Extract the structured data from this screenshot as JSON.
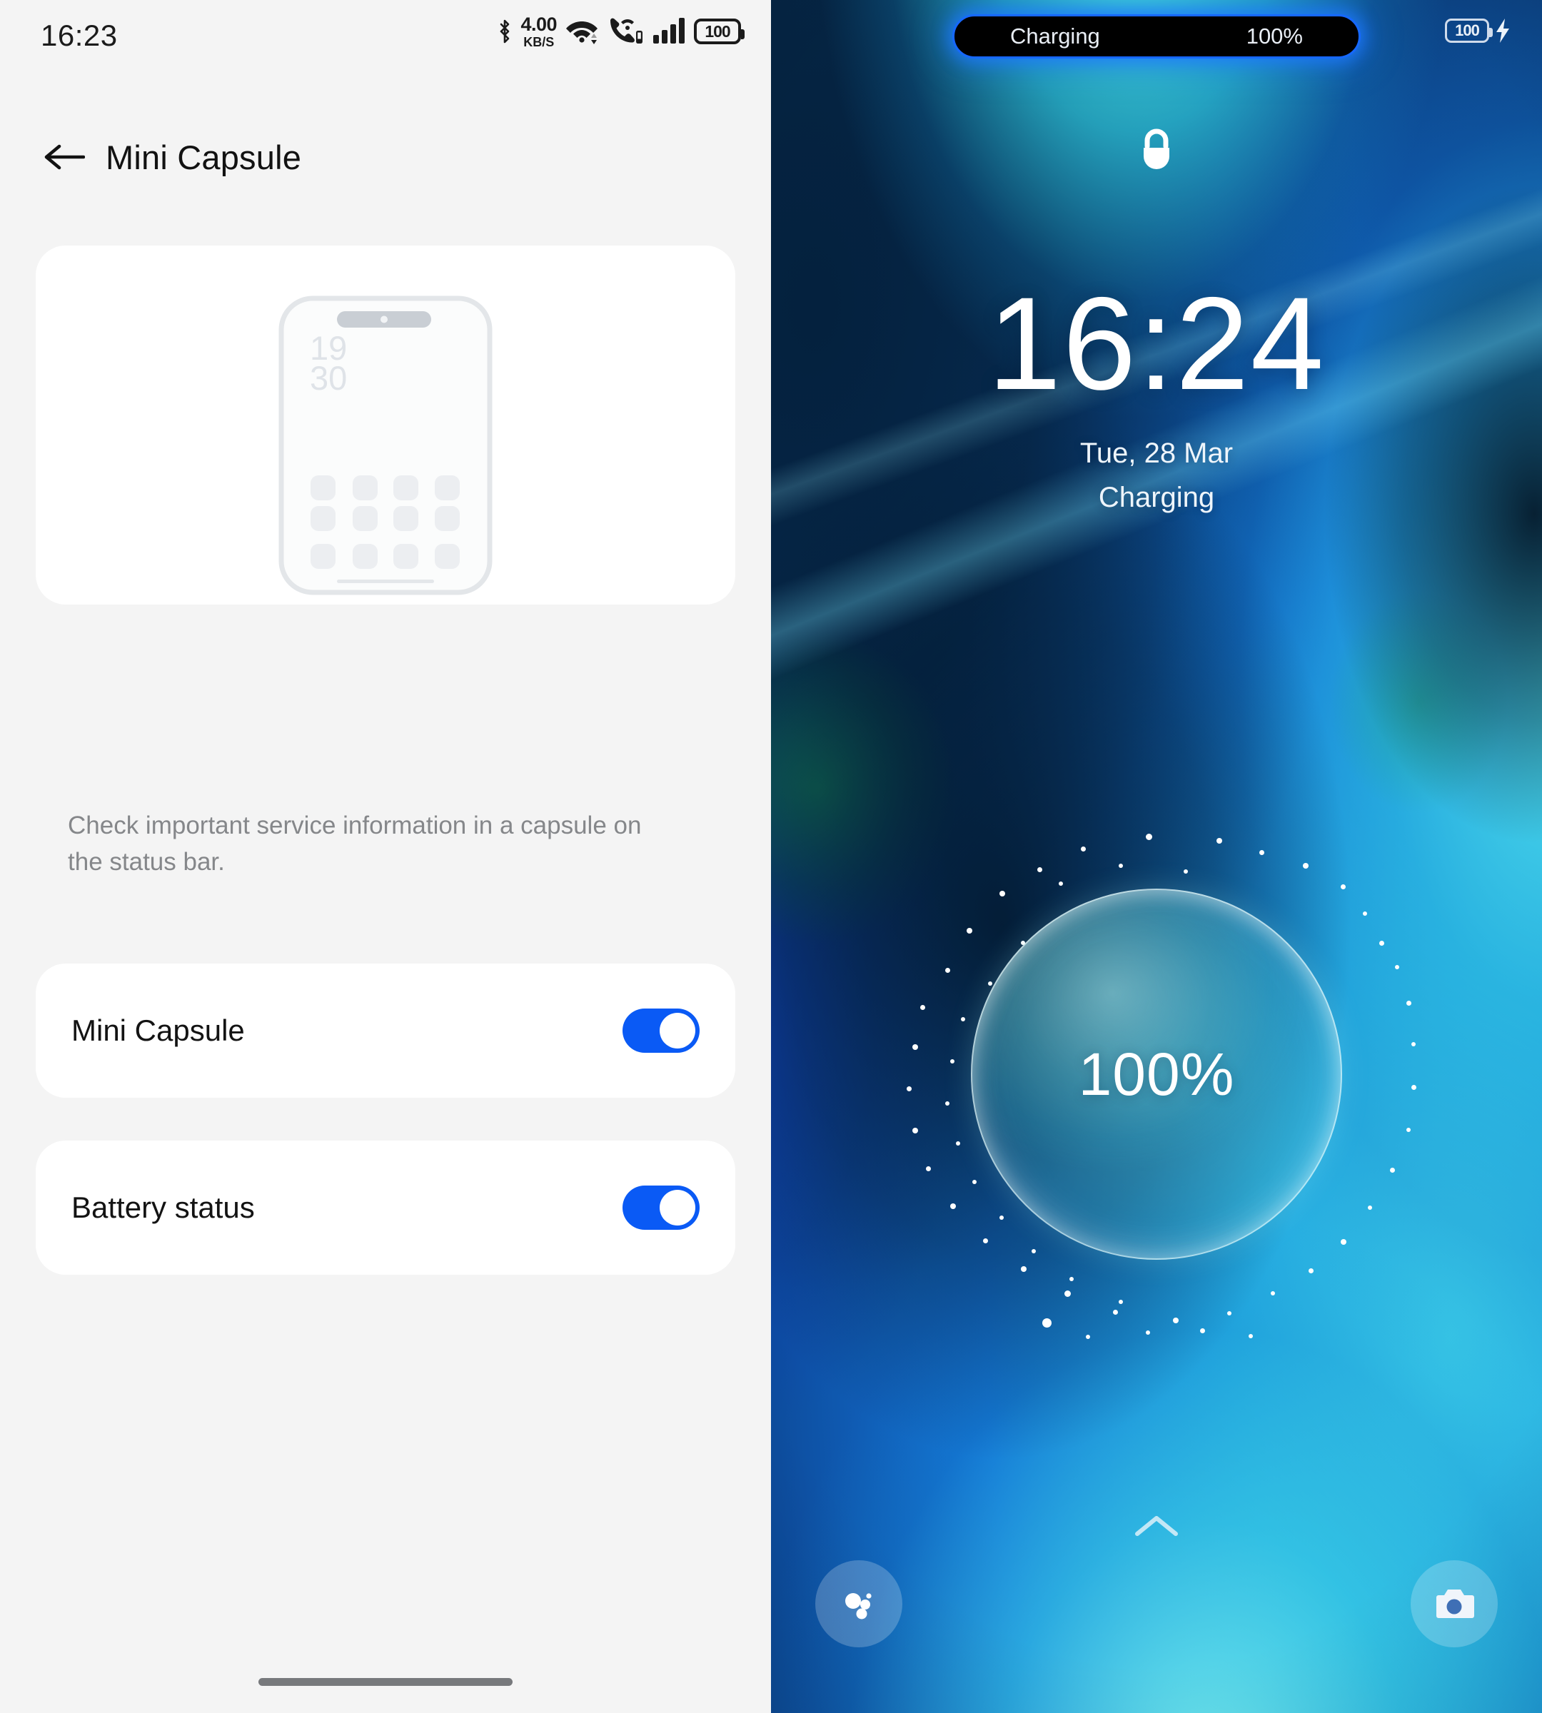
{
  "settings": {
    "status_bar": {
      "time": "16:23",
      "bluetooth_icon": "bluetooth-icon",
      "net_speed_value": "4.00",
      "net_speed_unit": "KB/S",
      "wifi_icon": "wifi-icon",
      "call_icon": "volte-call-icon",
      "signal_icon": "signal-bars-icon",
      "battery_level": "100"
    },
    "header": {
      "back_icon": "back-arrow-icon",
      "title": "Mini Capsule"
    },
    "illustration": {
      "name": "phone-preview-illustration",
      "capsule_dot": "capsule-indicator-dot",
      "clock_line1": "19",
      "clock_line2": "30"
    },
    "description": "Check important service information in a capsule on the status bar.",
    "rows": [
      {
        "label": "Mini Capsule",
        "enabled": true
      },
      {
        "label": "Battery status",
        "enabled": true
      }
    ],
    "home_indicator": "home-indicator-bar",
    "accent_color": "#0a5af5"
  },
  "lockscreen": {
    "status_bar": {
      "battery_level": "100",
      "charging_bolt_icon": "charging-bolt-icon"
    },
    "capsule": {
      "label": "Charging",
      "value": "100%",
      "glow_color": "#1668ff"
    },
    "lock_icon": "lock-icon",
    "clock": "16:24",
    "date": "Tue, 28 Mar",
    "charge_status": "Charging",
    "battery_orb": {
      "percent": "100%"
    },
    "unlock_hint_icon": "chevron-up-icon",
    "shortcuts": [
      {
        "name": "assistant-shortcut",
        "icon": "assistant-bubbles-icon"
      },
      {
        "name": "camera-shortcut",
        "icon": "camera-icon"
      }
    ]
  }
}
